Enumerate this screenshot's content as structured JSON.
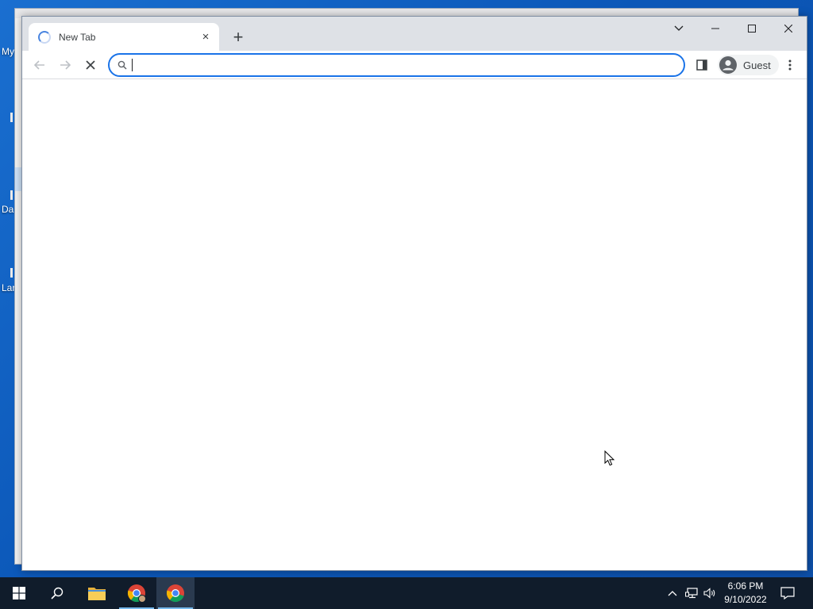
{
  "desktop": {
    "icon_labels": [
      "My",
      "Da",
      "Lar"
    ]
  },
  "browser": {
    "tab": {
      "title": "New Tab",
      "close_glyph": "×"
    },
    "new_tab_glyph": "+",
    "window_controls": {
      "tab_search_icon": "chevron-down-icon",
      "minimize_glyph": "—",
      "maximize_glyph": "☐",
      "close_glyph": "✕"
    },
    "omnibox": {
      "value": "",
      "placeholder": ""
    },
    "profile": {
      "label": "Guest"
    }
  },
  "taskbar": {
    "clock": {
      "time": "6:06 PM",
      "date": "9/10/2022"
    }
  },
  "colors": {
    "accent": "#1a73e8",
    "tab_strip": "#dee1e6",
    "taskbar": "#101c2b"
  }
}
